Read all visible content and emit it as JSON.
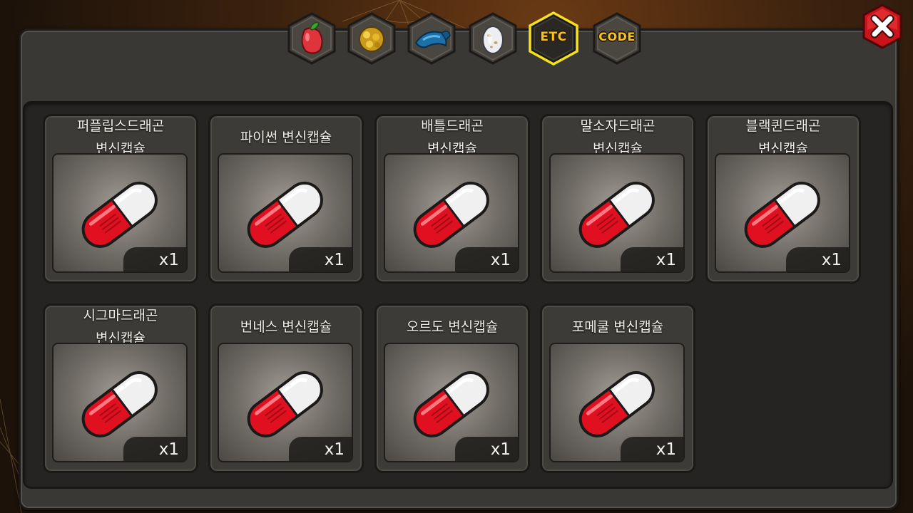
{
  "tabs": [
    {
      "id": "fruit",
      "icon": "red-fruit-icon",
      "label": ""
    },
    {
      "id": "nugget",
      "icon": "gold-nugget-icon",
      "label": ""
    },
    {
      "id": "fish",
      "icon": "blue-fish-icon",
      "label": ""
    },
    {
      "id": "egg",
      "icon": "spotted-egg-icon",
      "label": ""
    },
    {
      "id": "etc",
      "icon": "",
      "label": "ETC",
      "selected": true
    },
    {
      "id": "code",
      "icon": "",
      "label": "CODE"
    }
  ],
  "colors": {
    "selected_tab_border": "#f5e21c",
    "tab_label": "#f5c21a",
    "capsule_red": "#e01020",
    "close_red": "#d81a1a"
  },
  "items": [
    {
      "name": "퍼플립스드래곤\n변신캡슐",
      "qty": "x1",
      "icon": "red-capsule-icon"
    },
    {
      "name": "파이썬 변신캡슐",
      "qty": "x1",
      "icon": "red-capsule-icon"
    },
    {
      "name": "배틀드래곤\n변신캡슐",
      "qty": "x1",
      "icon": "red-capsule-icon"
    },
    {
      "name": "말소자드래곤\n변신캡슐",
      "qty": "x1",
      "icon": "red-capsule-icon"
    },
    {
      "name": "블랙퀸드래곤\n변신캡슐",
      "qty": "x1",
      "icon": "red-capsule-icon"
    },
    {
      "name": "시그마드래곤\n변신캡슐",
      "qty": "x1",
      "icon": "red-capsule-icon"
    },
    {
      "name": "번네스 변신캡슐",
      "qty": "x1",
      "icon": "red-capsule-icon"
    },
    {
      "name": "오르도 변신캡슐",
      "qty": "x1",
      "icon": "red-capsule-icon"
    },
    {
      "name": "포메쿨 변신캡슐",
      "qty": "x1",
      "icon": "red-capsule-icon"
    }
  ]
}
